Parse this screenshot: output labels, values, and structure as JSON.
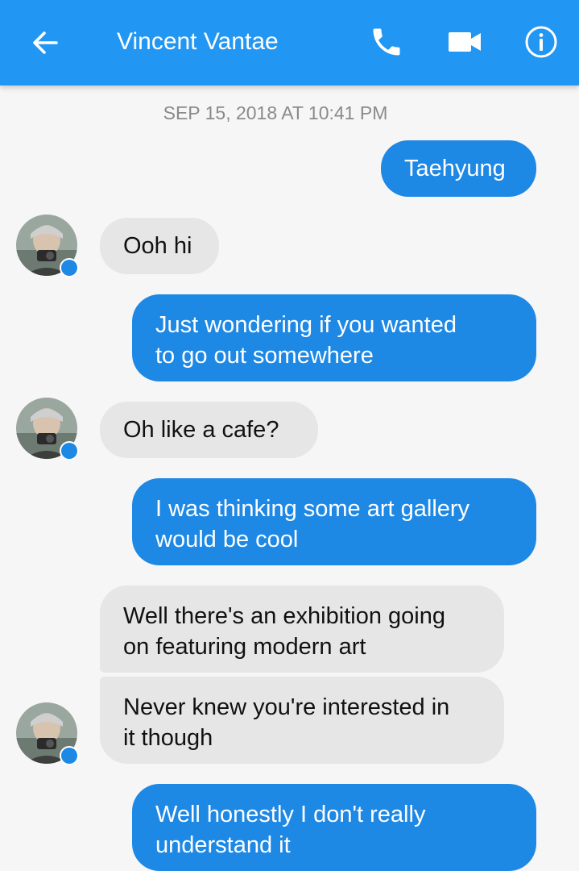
{
  "header": {
    "title": "Vincent Vantae",
    "back_icon": "arrow-left-icon",
    "call_icon": "phone-icon",
    "video_icon": "video-camera-icon",
    "info_icon": "info-icon",
    "accent_color": "#2196f3"
  },
  "conversation": {
    "timestamp": "SEP 15, 2018 AT 10:41 PM",
    "messages": [
      {
        "sender": "me",
        "text": "Taehyung"
      },
      {
        "sender": "contact",
        "text": "Ooh hi"
      },
      {
        "sender": "me",
        "lines": [
          "Just wondering if you wanted",
          "to go out somewhere"
        ]
      },
      {
        "sender": "contact",
        "text": "Oh like a cafe?"
      },
      {
        "sender": "me",
        "lines": [
          "I was thinking some art gallery",
          "would be cool"
        ]
      },
      {
        "sender": "contact",
        "lines": [
          "Well there's an exhibition going",
          "on featuring modern art"
        ]
      },
      {
        "sender": "contact",
        "lines": [
          "Never knew you're interested in",
          "it though"
        ]
      },
      {
        "sender": "me",
        "lines": [
          "Well honestly I don't really",
          "understand it"
        ]
      }
    ],
    "outgoing_color": "#1e88e5",
    "incoming_color": "#e6e6e6"
  }
}
